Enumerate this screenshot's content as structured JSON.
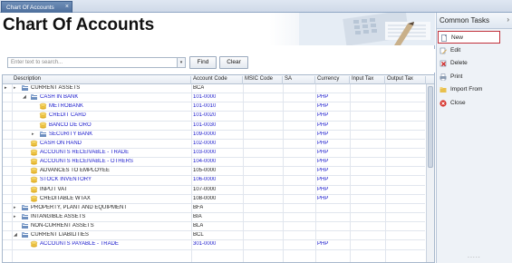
{
  "window_tab": {
    "label": "Chart Of Accounts",
    "close": "×"
  },
  "page": {
    "title": "Chart Of Accounts"
  },
  "search": {
    "placeholder": "Enter text to search...",
    "dropdown_glyph": "▾",
    "find_label": "Find",
    "clear_label": "Clear"
  },
  "grid": {
    "columns": [
      "Description",
      "Account Code",
      "MSIC Code",
      "SA",
      "Currency",
      "Input Tax",
      "Output Tax"
    ],
    "rows": [
      {
        "level": 0,
        "expander": "▸",
        "desc": "CURRENT ASSETS",
        "code": "BCA",
        "currency": "",
        "color": "black",
        "icon": "folder",
        "indicator": "▸"
      },
      {
        "level": 1,
        "expander": "◢",
        "desc": "CASH IN BANK",
        "code": "101-0000",
        "currency": "PHP",
        "color": "blue",
        "icon": "folder"
      },
      {
        "level": 2,
        "expander": "",
        "desc": "METROBANK",
        "code": "101-0010",
        "currency": "PHP",
        "color": "blue",
        "icon": "coins"
      },
      {
        "level": 2,
        "expander": "",
        "desc": "CREDIT CARD",
        "code": "101-0020",
        "currency": "PHP",
        "color": "blue",
        "icon": "coins"
      },
      {
        "level": 2,
        "expander": "",
        "desc": "BANCO DE ORO",
        "code": "101-0030",
        "currency": "PHP",
        "color": "blue",
        "icon": "coins"
      },
      {
        "level": 2,
        "expander": "▸",
        "desc": "SECURITY BANK",
        "code": "109-0000",
        "currency": "PHP",
        "color": "blue",
        "icon": "folder"
      },
      {
        "level": 1,
        "expander": "",
        "desc": "CASH ON HAND",
        "code": "102-0000",
        "currency": "PHP",
        "color": "blue",
        "icon": "coins"
      },
      {
        "level": 1,
        "expander": "",
        "desc": "ACCOUNTS RECEIVABLE - TRADE",
        "code": "103-0000",
        "currency": "PHP",
        "color": "blue",
        "icon": "coins"
      },
      {
        "level": 1,
        "expander": "",
        "desc": "ACCOUNTS RECEIVABLE - OTHERS",
        "code": "104-0000",
        "currency": "PHP",
        "color": "blue",
        "icon": "coins"
      },
      {
        "level": 1,
        "expander": "",
        "desc": "ADVANCES TO EMPLOYEE",
        "code": "105-0000",
        "currency": "PHP",
        "color": "black",
        "icon": "coins"
      },
      {
        "level": 1,
        "expander": "",
        "desc": "STOCK INVENTORY",
        "code": "106-0000",
        "currency": "PHP",
        "color": "blue",
        "icon": "coins"
      },
      {
        "level": 1,
        "expander": "",
        "desc": "INPUT VAT",
        "code": "107-0000",
        "currency": "PHP",
        "color": "black",
        "icon": "coins"
      },
      {
        "level": 1,
        "expander": "",
        "desc": "CREDITABLE WTAX",
        "code": "108-0000",
        "currency": "PHP",
        "color": "black",
        "icon": "coins"
      },
      {
        "level": 0,
        "expander": "▸",
        "desc": "PROPERTY, PLANT AND EQUIPMENT",
        "code": "BFA",
        "currency": "",
        "color": "black",
        "icon": "folder"
      },
      {
        "level": 0,
        "expander": "▸",
        "desc": "INTANGIBLE ASSETS",
        "code": "BIA",
        "currency": "",
        "color": "black",
        "icon": "folder"
      },
      {
        "level": 0,
        "expander": "",
        "desc": "NON-CURRENT ASSETS",
        "code": "BLA",
        "currency": "",
        "color": "black",
        "icon": "folder"
      },
      {
        "level": 0,
        "expander": "◢",
        "desc": "CURRENT LIABILITIES",
        "code": "BCL",
        "currency": "",
        "color": "black",
        "icon": "folder"
      },
      {
        "level": 1,
        "expander": "",
        "desc": "ACCOUNTS PAYABLE - TRADE",
        "code": "301-0000",
        "currency": "PHP",
        "color": "blue",
        "icon": "coins"
      }
    ]
  },
  "side_panel": {
    "title": "Common Tasks",
    "collapse_glyph": "›",
    "tasks": [
      {
        "label": "New",
        "icon": "new-document-icon",
        "highlighted": true
      },
      {
        "label": "Edit",
        "icon": "edit-icon",
        "highlighted": false
      },
      {
        "label": "Delete",
        "icon": "delete-icon",
        "highlighted": false
      },
      {
        "label": "Print",
        "icon": "print-icon",
        "highlighted": false
      },
      {
        "label": "Import From",
        "icon": "import-folder-icon",
        "highlighted": false
      },
      {
        "label": "Close",
        "icon": "close-icon",
        "highlighted": false
      }
    ],
    "grip": "....."
  },
  "colors": {
    "link_blue": "#1a1acc",
    "highlight_border": "#c0303a",
    "accent": "#4d6e9c"
  }
}
